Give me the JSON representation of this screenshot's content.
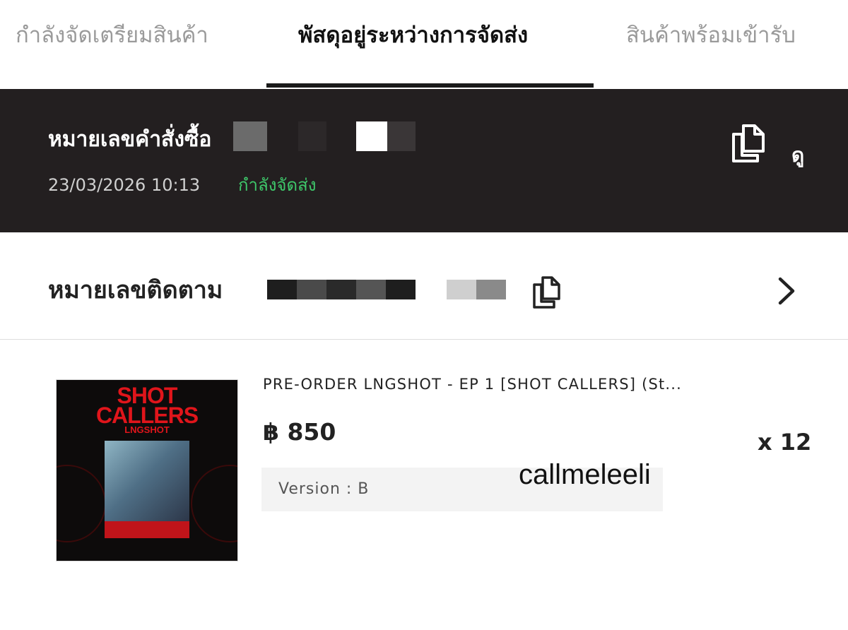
{
  "tabs": [
    {
      "label": "กำลังจัดเตรียมสินค้า",
      "active": false
    },
    {
      "label": "พัสดุอยู่ระหว่างการจัดส่ง",
      "active": true
    },
    {
      "label": "สินค้าพร้อมเข้ารับ",
      "active": false
    }
  ],
  "order": {
    "label": "หมายเลขคำสั่งซื้อ",
    "datetime": "23/03/2026 10:13",
    "status": "กำลังจัดส่ง",
    "status_color": "#3ec76a",
    "view_label": "ดู",
    "copy_icon": "copy-icon"
  },
  "tracking": {
    "label": "หมายเลขติดตาม",
    "copy_icon": "copy-icon",
    "chevron_icon": "chevron-right-icon"
  },
  "product": {
    "name": "PRE-ORDER LNGSHOT - EP 1 [SHOT CALLERS] (St...",
    "price": "฿ 850",
    "quantity": "x 12",
    "variant": "Version : B",
    "image_text": {
      "line1": "SHOT",
      "line2": "CALLERS",
      "line3": "LNGSHOT"
    }
  },
  "watermark": "callmeleeli",
  "colors": {
    "header_bg": "#231f20",
    "accent_green": "#3ec76a",
    "album_red": "#e0151b"
  }
}
